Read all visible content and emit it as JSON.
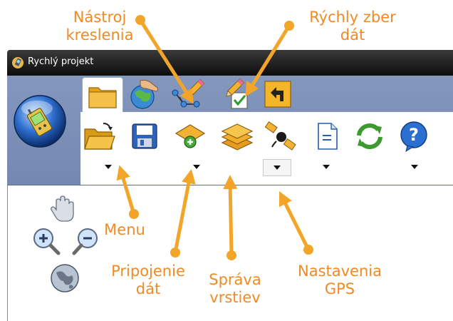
{
  "window": {
    "title": "Rychlý projekt"
  },
  "ribbon": {
    "tabs": [
      {
        "name": "folder-icon"
      },
      {
        "name": "globe-hand-icon"
      },
      {
        "name": "drawing-tool-icon"
      },
      {
        "name": "quick-data-collection-icon"
      },
      {
        "name": "back-arrow-icon"
      }
    ],
    "tools": [
      {
        "name": "open-folder-icon",
        "dropdown": true
      },
      {
        "name": "save-disk-icon",
        "dropdown": false
      },
      {
        "name": "add-data-icon",
        "dropdown": true
      },
      {
        "name": "layers-icon",
        "dropdown": false
      },
      {
        "name": "satellite-icon",
        "dropdown": true
      },
      {
        "name": "document-icon",
        "dropdown": true
      },
      {
        "name": "refresh-icon",
        "dropdown": false
      },
      {
        "name": "help-icon",
        "dropdown": true
      }
    ]
  },
  "nav_tools": [
    {
      "name": "pan-hand-icon"
    },
    {
      "name": "zoom-in-icon"
    },
    {
      "name": "zoom-out-icon"
    },
    {
      "name": "globe-icon"
    }
  ],
  "annotations": {
    "drawing_tool": "Nástroj\nkreslenia",
    "quick_collect": "Rýchly zber\ndát",
    "menu": "Menu",
    "attach_data": "Pripojenie\ndát",
    "layers": "Správa\nvrstiev",
    "gps": "Nastavenia\nGPS"
  },
  "colors": {
    "annotation": "#f08a24",
    "ribbon": "#7f92ba",
    "titlebar": "#1c1c1c"
  }
}
